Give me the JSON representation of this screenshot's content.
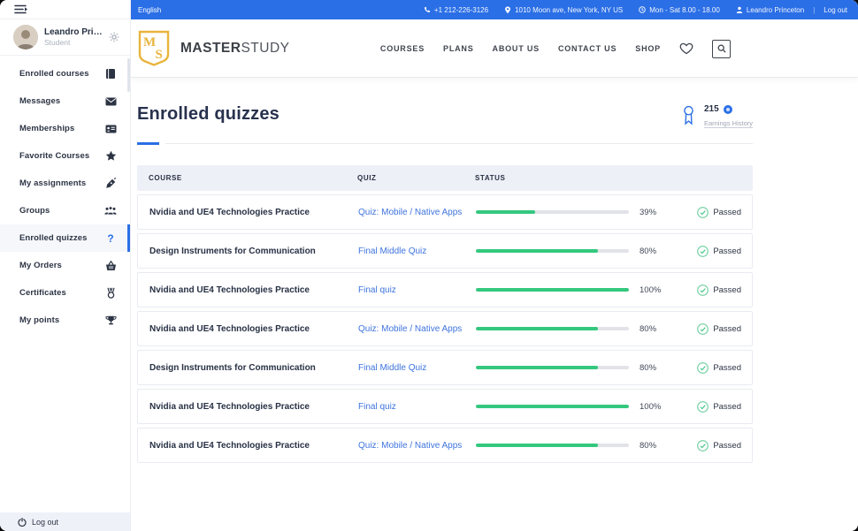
{
  "topbar": {
    "language": "English",
    "phone": "+1 212-226-3126",
    "address": "1010 Moon ave, New York, NY US",
    "hours": "Mon - Sat 8.00 - 18.00",
    "user": "Leandro Princeton",
    "separator": "|",
    "logout_label": "Log out"
  },
  "header": {
    "logo": {
      "monogram_m": "M",
      "monogram_s": "S",
      "primary": "MASTER",
      "secondary": "STUDY"
    },
    "nav": [
      "COURSES",
      "PLANS",
      "ABOUT US",
      "CONTACT US",
      "SHOP"
    ],
    "icons": [
      "heart-icon",
      "search-icon"
    ]
  },
  "sidebar": {
    "user": {
      "name": "Leandro Prince...",
      "role": "Student"
    },
    "items": [
      {
        "label": "Enrolled courses",
        "icon": "book-icon",
        "active": false
      },
      {
        "label": "Messages",
        "icon": "envelope-icon",
        "active": false
      },
      {
        "label": "Memberships",
        "icon": "id-card-icon",
        "active": false
      },
      {
        "label": "Favorite Courses",
        "icon": "star-icon",
        "active": false
      },
      {
        "label": "My assignments",
        "icon": "pen-icon",
        "active": false
      },
      {
        "label": "Groups",
        "icon": "users-icon",
        "active": false
      },
      {
        "label": "Enrolled quizzes",
        "icon": "question-icon",
        "active": true
      },
      {
        "label": "My Orders",
        "icon": "basket-icon",
        "active": false
      },
      {
        "label": "Certificates",
        "icon": "medal-icon",
        "active": false
      },
      {
        "label": "My points",
        "icon": "trophy-icon",
        "active": false
      }
    ],
    "logout_label": "Log out"
  },
  "page": {
    "title": "Enrolled quizzes",
    "points": "215",
    "earnings_link": "Earnings History"
  },
  "table": {
    "columns": [
      "COURSE",
      "QUIZ",
      "STATUS"
    ],
    "rows": [
      {
        "course": "Nvidia and UE4 Technologies Practice",
        "quiz": "Quiz: Mobile / Native Apps",
        "progress": 39,
        "percent": "39%",
        "status": "Passed"
      },
      {
        "course": "Design Instruments for Communication",
        "quiz": "Final Middle Quiz",
        "progress": 80,
        "percent": "80%",
        "status": "Passed"
      },
      {
        "course": "Nvidia and UE4 Technologies Practice",
        "quiz": "Final quiz",
        "progress": 100,
        "percent": "100%",
        "status": "Passed"
      },
      {
        "course": "Nvidia and UE4 Technologies Practice",
        "quiz": "Quiz: Mobile / Native Apps",
        "progress": 80,
        "percent": "80%",
        "status": "Passed"
      },
      {
        "course": "Design Instruments for Communication",
        "quiz": "Final Middle Quiz",
        "progress": 80,
        "percent": "80%",
        "status": "Passed"
      },
      {
        "course": "Nvidia and UE4 Technologies Practice",
        "quiz": "Final quiz",
        "progress": 100,
        "percent": "100%",
        "status": "Passed"
      },
      {
        "course": "Nvidia and UE4 Technologies Practice",
        "quiz": "Quiz: Mobile / Native Apps",
        "progress": 80,
        "percent": "80%",
        "status": "Passed"
      }
    ]
  },
  "colors": {
    "accent_blue": "#2b6fe6",
    "link_blue": "#3f74dd",
    "progress_green": "#34c87e",
    "passed_green": "#5ecb96",
    "navy_text": "#273044",
    "gold_logo": "#e9b43c",
    "table_head_bg": "#eef0f7",
    "logout_bar_bg": "#eef1f7"
  }
}
